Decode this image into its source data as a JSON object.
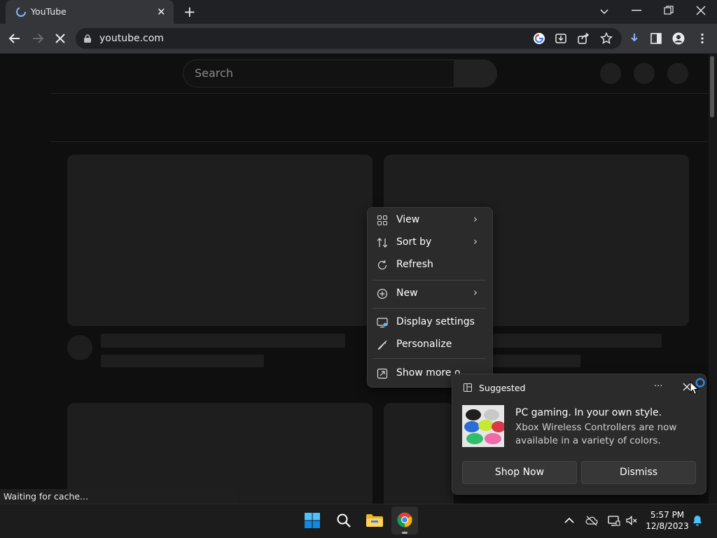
{
  "browser": {
    "tab_title": "YouTube",
    "url": "youtube.com",
    "status_text": "Waiting for cache..."
  },
  "page": {
    "search_placeholder": "Search"
  },
  "context_menu": {
    "items": [
      {
        "label": "View",
        "icon": "grid-icon",
        "has_submenu": true
      },
      {
        "label": "Sort by",
        "icon": "sort-icon",
        "has_submenu": true
      },
      {
        "label": "Refresh",
        "icon": "refresh-icon",
        "has_submenu": false
      },
      {
        "label": "New",
        "icon": "plus-circle-icon",
        "has_submenu": true
      },
      {
        "label": "Display settings",
        "icon": "display-icon",
        "has_submenu": false
      },
      {
        "label": "Personalize",
        "icon": "brush-icon",
        "has_submenu": false
      },
      {
        "label": "Show more o...",
        "icon": "expand-icon",
        "has_submenu": false
      }
    ]
  },
  "notification": {
    "title": "Suggested",
    "more": "···",
    "heading": "PC gaming. In your own style.",
    "body": "Xbox Wireless Controllers are now available in a variety of colors.",
    "primary_button": "Shop Now",
    "secondary_button": "Dismiss"
  },
  "taskbar": {
    "time": "5:57 PM",
    "date": "12/8/2023"
  },
  "colors": {
    "accent_blue": "#0078d4",
    "chrome_red": "#db4437",
    "chrome_green": "#0f9d58",
    "chrome_yellow": "#f4b400"
  }
}
